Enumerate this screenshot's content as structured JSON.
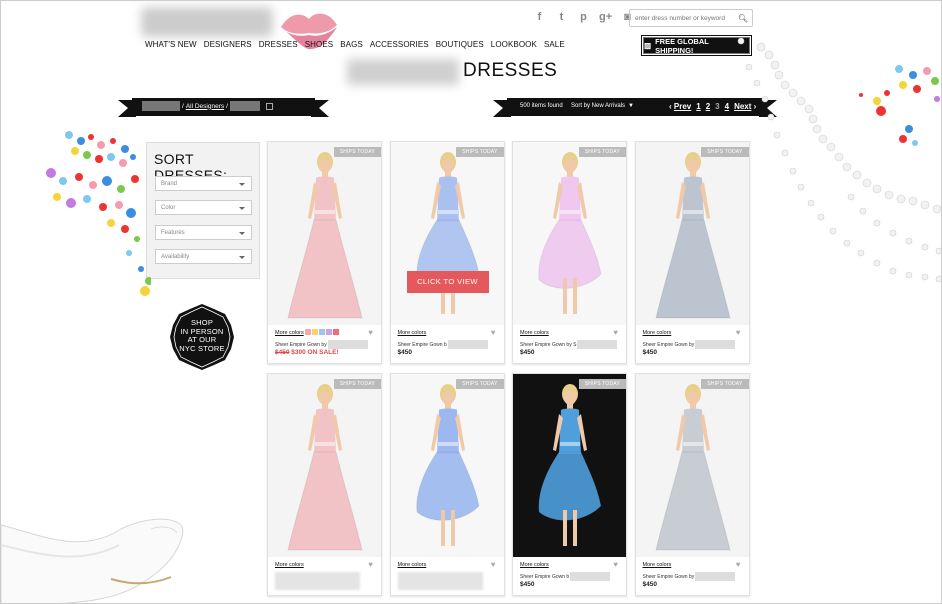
{
  "header": {
    "social": [
      {
        "icon": "facebook-icon",
        "glyph": "f"
      },
      {
        "icon": "twitter-icon",
        "glyph": "t"
      },
      {
        "icon": "pinterest-icon",
        "glyph": "p"
      },
      {
        "icon": "google-plus-icon",
        "glyph": "g+"
      },
      {
        "icon": "instagram-icon",
        "glyph": "◙"
      }
    ],
    "search_placeholder": "enter dress number or keyword",
    "nav": [
      "WHAT'S NEW",
      "DESIGNERS",
      "DRESSES",
      "SHOES",
      "BAGS",
      "ACCESSORIES",
      "BOUTIQUES",
      "LOOKBOOK",
      "SALE"
    ],
    "shipping_label": "FREE GLOBAL SHIPPING!",
    "page_title": "DRESSES"
  },
  "breadcrumb": {
    "sep1": "/",
    "link": "All Designers",
    "sep2": "/"
  },
  "toolbar": {
    "items_found": "500 items found",
    "sort_label": "Sort by New Arrivals",
    "prev": "Prev",
    "pages": [
      "1",
      "2",
      "3",
      "4"
    ],
    "current_page": "3",
    "next": "Next"
  },
  "sidebar": {
    "title": "SORT DRESSES:",
    "filters": [
      "Brand",
      "Color",
      "Features",
      "Availability"
    ],
    "store_badge": [
      "SHOP",
      "IN PERSON",
      "AT OUR",
      "NYC STORE"
    ]
  },
  "products_common": {
    "ships_label": "SHIPS TODAY",
    "more_colors": "More colors",
    "click_to_view": "CLICK TO VIEW"
  },
  "products": [
    {
      "name": "Sheer Empire Gown by",
      "price": "",
      "old_price": "$450",
      "sale_price": "$300 ON SALE!",
      "dress_color": "#f2c3c6",
      "bg": "#f4f4f4",
      "swatches": [
        "#f5a8b2",
        "#f5d36a",
        "#9ec6ef",
        "#c9a3e4",
        "#f06b7b"
      ]
    },
    {
      "name": "Sheer Empire Gown b",
      "price": "$450",
      "dress_color": "#a9c0f0",
      "bg": "#f7f7f7",
      "swatches": []
    },
    {
      "name": "Sheer Empire Gown by S",
      "price": "$450",
      "dress_color": "#efc7ef",
      "bg": "#f7f7f7",
      "swatches": []
    },
    {
      "name": "Sheer Empire Gown by",
      "price": "$450",
      "dress_color": "#bcc5cf",
      "bg": "#f4f4f4",
      "swatches": []
    },
    {
      "name": "",
      "price": "",
      "dress_color": "#f2c3c6",
      "bg": "#f4f4f4",
      "swatches": []
    },
    {
      "name": "",
      "price": "",
      "dress_color": "#9db8f0",
      "bg": "#f7f7f7",
      "swatches": []
    },
    {
      "name": "Sheer Empire Gown b",
      "price": "$450",
      "dress_color": "#4f9fdc",
      "bg": "#111111",
      "swatches": []
    },
    {
      "name": "Sheer Empire Gown by",
      "price": "$450",
      "dress_color": "#c8ccd3",
      "bg": "#f4f4f4",
      "swatches": []
    }
  ]
}
